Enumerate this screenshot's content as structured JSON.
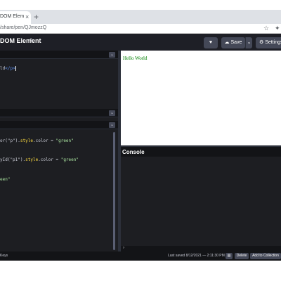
{
  "browser": {
    "tab_title": "DOM Elem",
    "tab_close": "×",
    "new_tab": "+",
    "url": "/share/pen/QJmozzQ",
    "star": "☆",
    "extension": "✦"
  },
  "header": {
    "title": "DOM Element",
    "pencil": "✎",
    "heart": "♥",
    "save_label": "☁ Save",
    "save_caret": "⌄",
    "settings_label": "⚙ Settings"
  },
  "panes": {
    "html": {
      "collapse": "⌄",
      "line": {
        "pre": "ld",
        "close_tag": "</p>"
      }
    },
    "css": {
      "collapse": "⌄"
    },
    "js": {
      "collapse": "⌄",
      "line1": {
        "a": "or(\"p\").",
        "b": "style",
        "c": ".color = ",
        "d": "\"green\""
      },
      "line2": {
        "a": "yId(\"p1\").",
        "b": "style",
        "c": ".color = ",
        "d": "\"green\""
      },
      "line3": {
        "d": "een\""
      }
    }
  },
  "result": {
    "text": "Hello World"
  },
  "console": {
    "title": "Console",
    "prompt": "›"
  },
  "footer": {
    "keys": "Keys",
    "last_saved": "Last saved 8/12/2021 — 2:11:30 PM",
    "layout_icon": "▤",
    "delete": "Delete",
    "add_to_collection": "Add to Collection"
  }
}
